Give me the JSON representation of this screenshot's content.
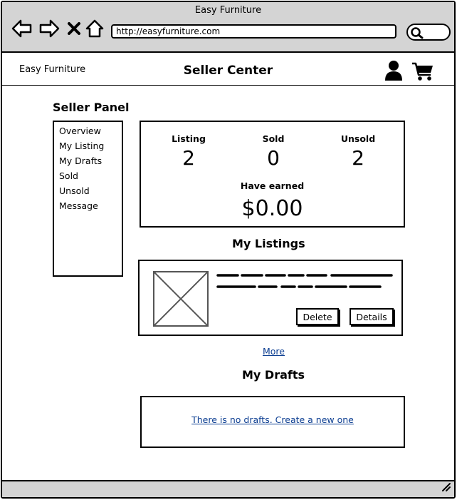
{
  "browser": {
    "title": "Easy Furniture",
    "url": "http://easyfurniture.com"
  },
  "header": {
    "brand": "Easy Furniture",
    "title": "Seller Center"
  },
  "sidebar": {
    "title": "Seller Panel",
    "items": [
      {
        "label": "Overview"
      },
      {
        "label": "My Listing"
      },
      {
        "label": "My Drafts"
      },
      {
        "label": "Sold"
      },
      {
        "label": "Unsold"
      },
      {
        "label": "Message"
      }
    ]
  },
  "stats": {
    "listing": {
      "label": "Listing",
      "value": "2"
    },
    "sold": {
      "label": "Sold",
      "value": "0"
    },
    "unsold": {
      "label": "Unsold",
      "value": "2"
    },
    "earned": {
      "label": "Have earned",
      "value": "$0.00"
    }
  },
  "listings": {
    "title": "My Listings",
    "item": {
      "delete_label": "Delete",
      "details_label": "Details"
    },
    "more_label": "More"
  },
  "drafts": {
    "title": "My Drafts",
    "empty_label": "There is no drafts. Create a new one"
  }
}
